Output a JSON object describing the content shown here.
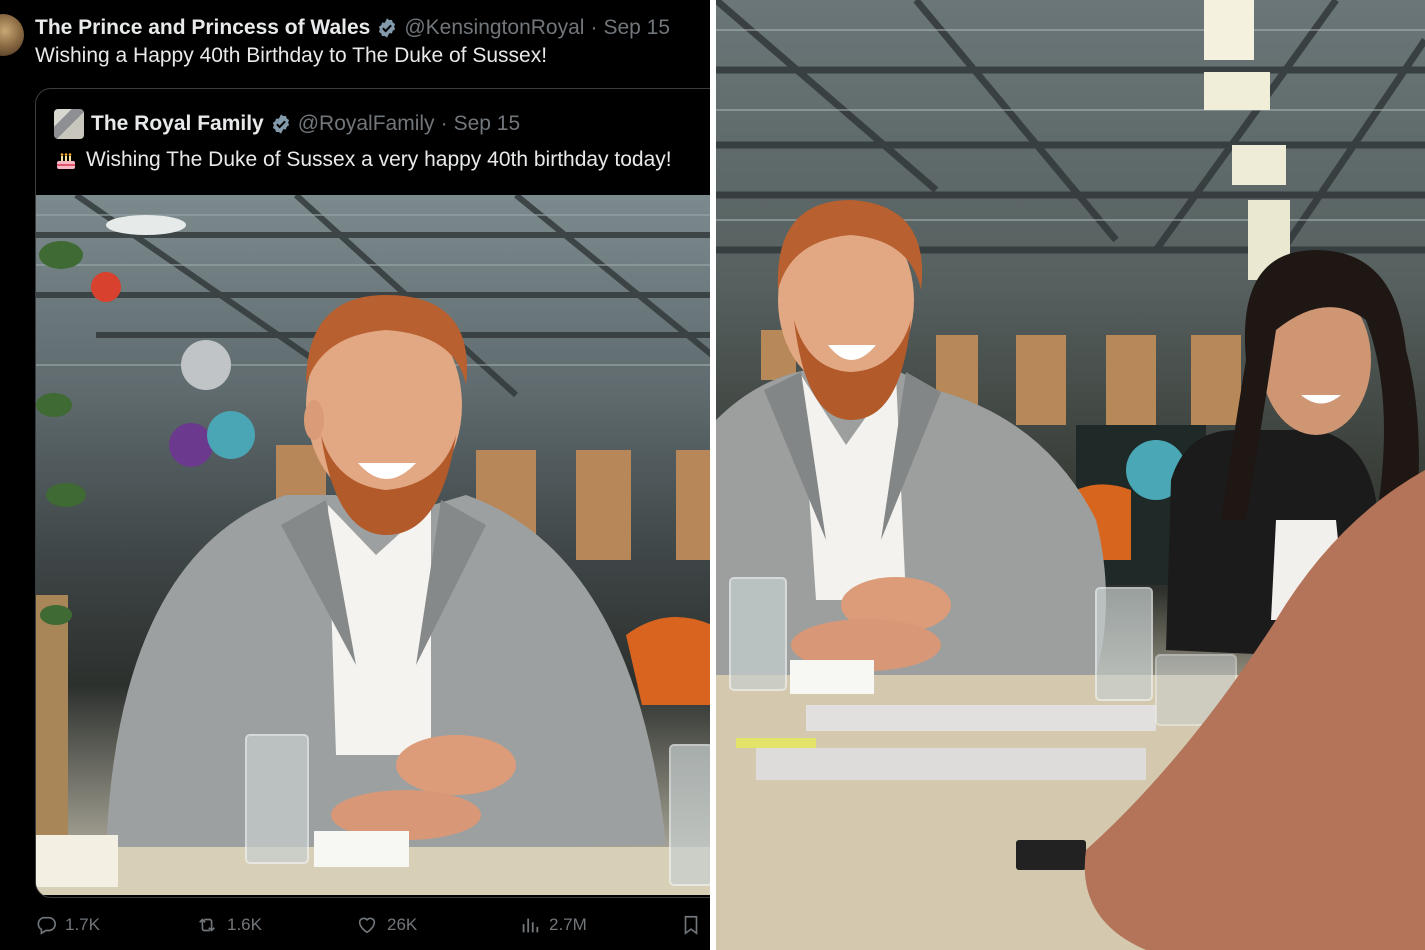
{
  "post": {
    "author": "The Prince and Princess of Wales",
    "handle": "@KensingtonRoyal",
    "separator": "·",
    "date": "Sep 15",
    "text": "Wishing a Happy 40th Birthday to The Duke of Sussex!"
  },
  "quoted_post": {
    "author": "The Royal Family",
    "handle": "@RoyalFamily",
    "separator": "·",
    "date": "Sep 15",
    "text": "Wishing The Duke of Sussex a very happy 40th birthday today!",
    "emoji_icon": "birthday-cake-icon"
  },
  "actions": {
    "replies": "1.7K",
    "reposts": "1.6K",
    "likes": "26K",
    "views": "2.7M"
  },
  "colors": {
    "background": "#000000",
    "text_primary": "#e7e9ea",
    "text_secondary": "#71767b",
    "verified": "#829aab",
    "border": "#3a3d40"
  }
}
